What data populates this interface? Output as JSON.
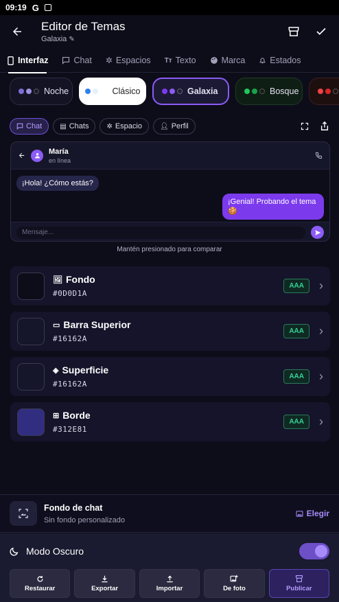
{
  "status_bar": {
    "time": "09:19",
    "google": "G"
  },
  "header": {
    "title": "Editor de Temas",
    "subtitle": "Galaxia"
  },
  "tabs": [
    {
      "label": "Interfaz",
      "icon": "phone-icon",
      "active": true
    },
    {
      "label": "Chat",
      "icon": "chat-icon",
      "active": false
    },
    {
      "label": "Espacios",
      "icon": "spacing-icon",
      "active": false
    },
    {
      "label": "Texto",
      "icon": "text-icon",
      "active": false
    },
    {
      "label": "Marca",
      "icon": "palette-icon",
      "active": false
    },
    {
      "label": "Estados",
      "icon": "bell-icon",
      "active": false
    }
  ],
  "themes": [
    {
      "label": "Noche",
      "dots": [
        "#7B6FD6",
        "#9A8FE0",
        "#1A1A2E"
      ]
    },
    {
      "label": "Clásico",
      "dots": [
        "#2F80ED",
        "#E6F0FA"
      ]
    },
    {
      "label": "Galaxia",
      "dots": [
        "#7C3AED",
        "#8B5CF6",
        "#1E1B3A"
      ],
      "selected": true
    },
    {
      "label": "Bosque",
      "dots": [
        "#22C55E",
        "#16A34A",
        "#0F1E14"
      ]
    },
    {
      "label": "",
      "dots": [
        "#EF4444",
        "#DC2626",
        "#1E0F0F"
      ]
    }
  ],
  "preview_tabs": [
    {
      "label": "Chat",
      "active": true
    },
    {
      "label": "Chats",
      "active": false
    },
    {
      "label": "Espacio",
      "active": false
    },
    {
      "label": "Perfil",
      "active": false
    }
  ],
  "preview": {
    "contact_name": "María",
    "contact_status": "en línea",
    "msg_in": "¡Hola! ¿Cómo estás?",
    "msg_out": "¡Genial! Probando el tema 🍪",
    "input_placeholder": "Mensaje..."
  },
  "hint": "Mantén presionado para comparar",
  "colors": [
    {
      "name": "Fondo",
      "hex": "#0D0D1A",
      "badge": "AAA"
    },
    {
      "name": "Barra Superior",
      "hex": "#16162A",
      "badge": "AAA"
    },
    {
      "name": "Superficie",
      "hex": "#16162A",
      "badge": "AAA"
    },
    {
      "name": "Borde",
      "hex": "#312E81",
      "badge": "AAA"
    }
  ],
  "chat_background": {
    "title": "Fondo de chat",
    "subtitle": "Sin fondo personalizado",
    "action": "Elegir"
  },
  "dark_mode": {
    "label": "Modo Oscuro",
    "on": true
  },
  "actions": [
    {
      "label": "Restaurar",
      "icon": "refresh-icon"
    },
    {
      "label": "Exportar",
      "icon": "download-icon"
    },
    {
      "label": "Importar",
      "icon": "upload-icon"
    },
    {
      "label": "De foto",
      "icon": "image-add-icon"
    },
    {
      "label": "Publicar",
      "icon": "store-icon"
    }
  ],
  "accent_color": "#8B5CF6"
}
